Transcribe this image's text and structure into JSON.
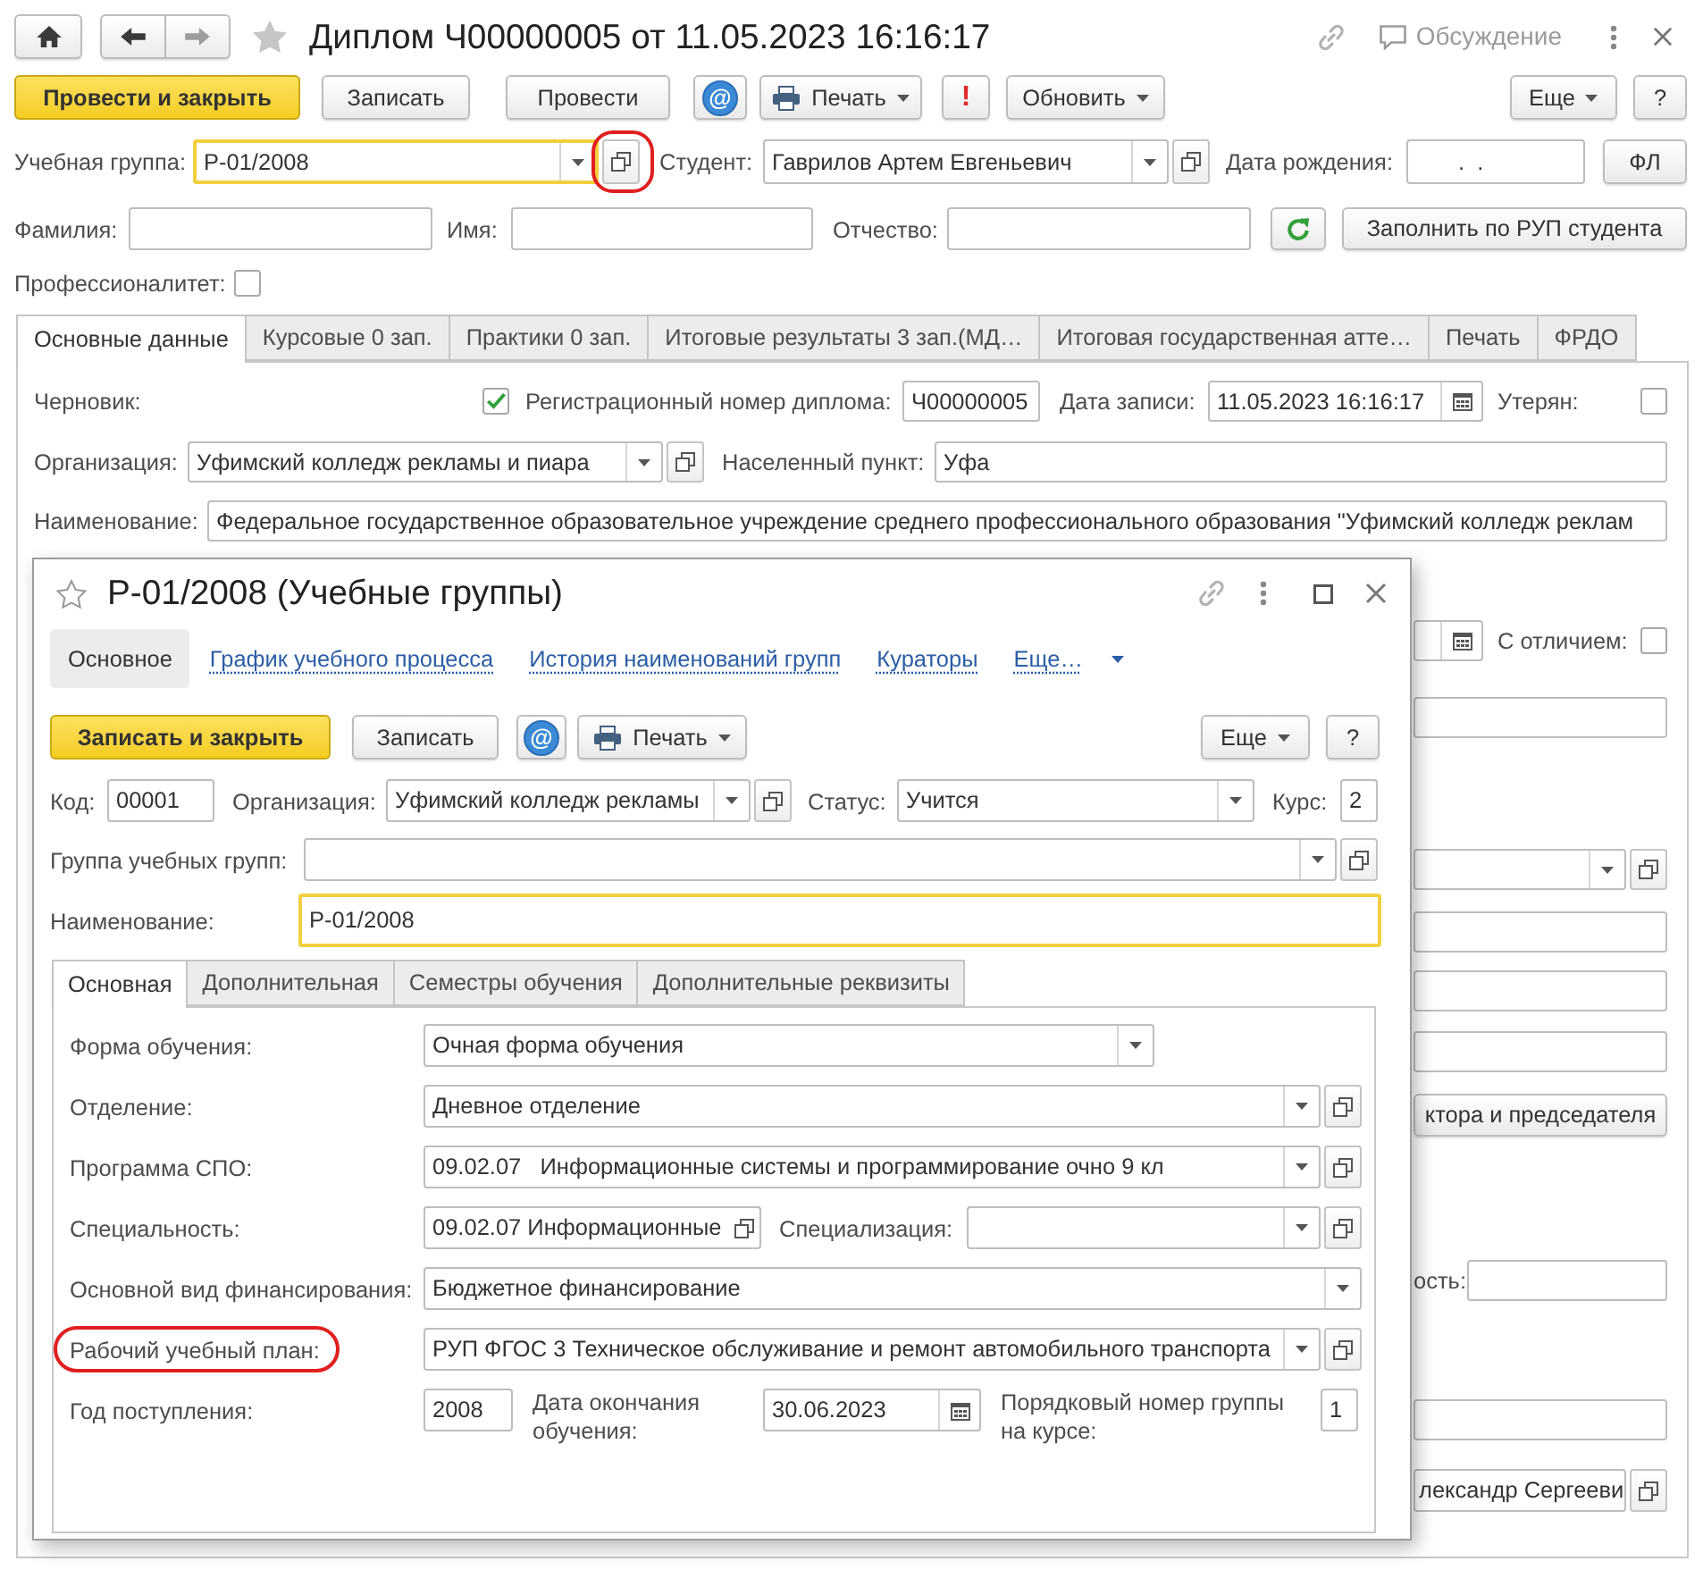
{
  "window": {
    "title": "Диплом Ч00000005 от 11.05.2023 16:16:17",
    "discussion": "Обсуждение"
  },
  "toolbar": {
    "left": [
      {
        "kind": "primary",
        "label": "Провести и закрыть"
      },
      {
        "kind": "plain",
        "label": "Записать"
      },
      {
        "kind": "plain",
        "label": "Провести"
      },
      {
        "kind": "mail",
        "label": "@"
      },
      {
        "kind": "print",
        "label": "Печать"
      },
      {
        "kind": "alert",
        "label": "!"
      },
      {
        "kind": "menu",
        "label": "Обновить"
      }
    ],
    "right": [
      {
        "kind": "menu",
        "label": "Еще"
      },
      {
        "kind": "plain",
        "label": "?"
      }
    ]
  },
  "header_rows": [
    {
      "items": [
        {
          "kind": "label",
          "text": "Учебная группа:"
        },
        {
          "kind": "ref",
          "value": "Р-01/2008",
          "focused": true,
          "circled": true
        },
        {
          "kind": "label",
          "text": "Студент:"
        },
        {
          "kind": "ref",
          "value": "Гаврилов Артем Евгеньевич",
          "focused": false
        },
        {
          "kind": "label",
          "text": "Дата рождения:"
        },
        {
          "kind": "mask",
          "value": ".  .",
          "focused": false
        },
        {
          "kind": "button",
          "label": "ФЛ"
        }
      ]
    },
    {
      "items": [
        {
          "kind": "label",
          "text": "Фамилия:"
        },
        {
          "kind": "text",
          "focused": false
        },
        {
          "kind": "label",
          "text": "Имя:"
        },
        {
          "kind": "text",
          "focused": false
        },
        {
          "kind": "label",
          "text": "Отчество:"
        },
        {
          "kind": "text",
          "focused": false
        },
        {
          "kind": "refresh"
        },
        {
          "kind": "button",
          "label": "Заполнить по РУП студента"
        }
      ]
    },
    {
      "items": [
        {
          "kind": "label",
          "text": "Профессионалитет:"
        },
        {
          "kind": "check",
          "checked": false
        }
      ]
    }
  ],
  "tabs": [
    {
      "label": "Основные данные",
      "selected": true
    },
    {
      "label": "Курсовые 0 зап.",
      "selected": false
    },
    {
      "label": "Практики 0 зап.",
      "selected": false
    },
    {
      "label": "Итоговые результаты 3 зап.(МД…",
      "selected": false
    },
    {
      "label": "Итоговая государственная атте…",
      "selected": false
    },
    {
      "label": "Печать",
      "selected": false
    },
    {
      "label": "ФРДО",
      "selected": false
    }
  ],
  "tab_content": {
    "rows": [
      {
        "items": [
          {
            "kind": "label",
            "text": "Черновик:"
          },
          {
            "kind": "check",
            "checked": true
          },
          {
            "kind": "label",
            "text": "Регистрационный номер диплома:"
          },
          {
            "kind": "text",
            "value": "Ч00000005",
            "focused": false
          },
          {
            "kind": "label",
            "text": "Дата записи:"
          },
          {
            "kind": "date",
            "value": "11.05.2023 16:16:17",
            "focused": false
          },
          {
            "kind": "label",
            "text": "Утерян:"
          },
          {
            "kind": "check",
            "checked": false
          }
        ]
      },
      {
        "items": [
          {
            "kind": "label",
            "text": "Организация:"
          },
          {
            "kind": "ref",
            "value": "Уфимский колледж рекламы и пиара",
            "focused": false
          },
          {
            "kind": "label",
            "text": "Населенный пункт:"
          },
          {
            "kind": "text",
            "value": "Уфа",
            "focused": false
          }
        ]
      },
      {
        "items": [
          {
            "kind": "label",
            "text": "Наименование:"
          },
          {
            "kind": "text",
            "value": "Федеральное государственное образовательное учреждение среднего профессионального образования \"Уфимский колледж реклам",
            "focused": false
          }
        ]
      },
      {
        "items": [
          {
            "kind": "date",
            "focused": false
          },
          {
            "kind": "label",
            "text": "С отличием:"
          },
          {
            "kind": "check",
            "checked": false
          }
        ]
      },
      {
        "items": [
          {
            "kind": "text",
            "focused": false
          }
        ]
      },
      {
        "items": [
          {
            "kind": "ref",
            "focused": false
          }
        ]
      },
      {
        "items": [
          {
            "kind": "text",
            "focused": false
          }
        ]
      },
      {
        "items": [
          {
            "kind": "text",
            "focused": false
          }
        ]
      },
      {
        "items": [
          {
            "kind": "text",
            "focused": false
          }
        ]
      },
      {
        "items": [
          {
            "kind": "button",
            "label": "ктора и председателя"
          }
        ]
      },
      {
        "items": [
          {
            "kind": "label",
            "text": "ость:"
          },
          {
            "kind": "text",
            "focused": false
          }
        ]
      },
      {
        "items": [
          {
            "kind": "text",
            "focused": false
          }
        ]
      },
      {
        "items": [
          {
            "kind": "open",
            "value": "лександр Сергееви",
            "focused": false
          }
        ]
      }
    ]
  },
  "dialog": {
    "title": "Р-01/2008 (Учебные группы)",
    "nav": [
      {
        "kind": "page",
        "label": "Основное",
        "selected": true
      },
      {
        "kind": "page",
        "label": "График учебного процесса",
        "selected": false
      },
      {
        "kind": "page",
        "label": "История наименований групп",
        "selected": false
      },
      {
        "kind": "page",
        "label": "Кураторы",
        "selected": false
      },
      {
        "kind": "menu",
        "label": "Еще…",
        "selected": false
      }
    ],
    "toolbar": {
      "left": [
        {
          "kind": "primary",
          "label": "Записать и закрыть"
        },
        {
          "kind": "plain",
          "label": "Записать"
        },
        {
          "kind": "mail",
          "label": "@"
        },
        {
          "kind": "print",
          "label": "Печать"
        }
      ],
      "right": [
        {
          "kind": "menu",
          "label": "Еще"
        },
        {
          "kind": "plain",
          "label": "?"
        }
      ]
    },
    "rows": [
      {
        "items": [
          {
            "kind": "label",
            "text": "Код:"
          },
          {
            "kind": "text",
            "value": "00001",
            "focused": false
          },
          {
            "kind": "label",
            "text": "Организация:"
          },
          {
            "kind": "ref",
            "value": "Уфимский колледж рекламы",
            "focused": false
          },
          {
            "kind": "label",
            "text": "Статус:"
          },
          {
            "kind": "select",
            "value": "Учится",
            "focused": false
          },
          {
            "kind": "label",
            "text": "Курс:"
          },
          {
            "kind": "text",
            "value": "2",
            "focused": false
          }
        ]
      },
      {
        "items": [
          {
            "kind": "label",
            "text": "Группа учебных групп:"
          },
          {
            "kind": "ref",
            "focused": false
          }
        ]
      },
      {
        "items": [
          {
            "kind": "label",
            "text": "Наименование:"
          },
          {
            "kind": "text",
            "value": "Р-01/2008",
            "focused": true
          }
        ]
      }
    ],
    "tabs": [
      {
        "label": "Основная",
        "selected": true
      },
      {
        "label": "Дополнительная",
        "selected": false
      },
      {
        "label": "Семестры обучения",
        "selected": false
      },
      {
        "label": "Дополнительные реквизиты",
        "selected": false
      }
    ],
    "tab_content": {
      "rows": [
        {
          "items": [
            {
              "kind": "label",
              "text": "Форма обучения:"
            },
            {
              "kind": "select",
              "value": "Очная форма обучения",
              "focused": false
            }
          ]
        },
        {
          "items": [
            {
              "kind": "label",
              "text": "Отделение:"
            },
            {
              "kind": "ref",
              "value": "Дневное отделение",
              "focused": false
            }
          ]
        },
        {
          "items": [
            {
              "kind": "label",
              "text": "Программа СПО:"
            },
            {
              "kind": "ref",
              "value": "09.02.07   Информационные системы и программирование очно 9 кл",
              "focused": false
            }
          ]
        },
        {
          "items": [
            {
              "kind": "label",
              "text": "Специальность:"
            },
            {
              "kind": "link",
              "value": "09.02.07 Информационные",
              "focused": false
            },
            {
              "kind": "label",
              "text": "Специализация:"
            },
            {
              "kind": "ref",
              "focused": false
            }
          ]
        },
        {
          "items": [
            {
              "kind": "label",
              "text": "Основной вид финансирования:"
            },
            {
              "kind": "select",
              "value": "Бюджетное финансирование",
              "focused": false
            }
          ]
        },
        {
          "items": [
            {
              "kind": "label",
              "text": "Рабочий учебный план:",
              "circled": true
            },
            {
              "kind": "ref",
              "value": "РУП ФГОС 3 Техническое обслуживание и ремонт автомобильного транспорта",
              "focused": false
            }
          ]
        },
        {
          "items": [
            {
              "kind": "label",
              "text": "Год поступления:"
            },
            {
              "kind": "text",
              "value": "2008",
              "focused": false
            },
            {
              "kind": "label",
              "text": "Дата окончания обучения:"
            },
            {
              "kind": "date",
              "value": "30.06.2023",
              "focused": false
            },
            {
              "kind": "label",
              "text": "Порядковый номер группы на курсе:"
            },
            {
              "kind": "text",
              "value": "1",
              "focused": false
            }
          ]
        }
      ]
    }
  }
}
